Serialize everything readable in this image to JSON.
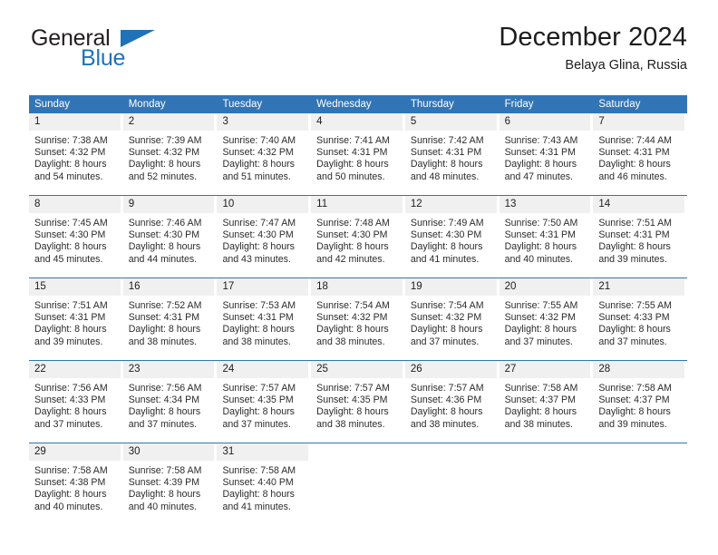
{
  "brand": {
    "name_part1": "General",
    "name_part2": "Blue",
    "logo_icon": "triangle-flag-icon",
    "accent_color": "#1f72b8"
  },
  "header": {
    "title": "December 2024",
    "subtitle": "Belaya Glina, Russia"
  },
  "calendar": {
    "header_color": "#3275b6",
    "daynum_bg": "#f0f0f0",
    "weekday_headers": [
      "Sunday",
      "Monday",
      "Tuesday",
      "Wednesday",
      "Thursday",
      "Friday",
      "Saturday"
    ],
    "weeks": [
      [
        {
          "day": "1",
          "sunrise": "Sunrise: 7:38 AM",
          "sunset": "Sunset: 4:32 PM",
          "daylight_line1": "Daylight: 8 hours",
          "daylight_line2": "and 54 minutes."
        },
        {
          "day": "2",
          "sunrise": "Sunrise: 7:39 AM",
          "sunset": "Sunset: 4:32 PM",
          "daylight_line1": "Daylight: 8 hours",
          "daylight_line2": "and 52 minutes."
        },
        {
          "day": "3",
          "sunrise": "Sunrise: 7:40 AM",
          "sunset": "Sunset: 4:32 PM",
          "daylight_line1": "Daylight: 8 hours",
          "daylight_line2": "and 51 minutes."
        },
        {
          "day": "4",
          "sunrise": "Sunrise: 7:41 AM",
          "sunset": "Sunset: 4:31 PM",
          "daylight_line1": "Daylight: 8 hours",
          "daylight_line2": "and 50 minutes."
        },
        {
          "day": "5",
          "sunrise": "Sunrise: 7:42 AM",
          "sunset": "Sunset: 4:31 PM",
          "daylight_line1": "Daylight: 8 hours",
          "daylight_line2": "and 48 minutes."
        },
        {
          "day": "6",
          "sunrise": "Sunrise: 7:43 AM",
          "sunset": "Sunset: 4:31 PM",
          "daylight_line1": "Daylight: 8 hours",
          "daylight_line2": "and 47 minutes."
        },
        {
          "day": "7",
          "sunrise": "Sunrise: 7:44 AM",
          "sunset": "Sunset: 4:31 PM",
          "daylight_line1": "Daylight: 8 hours",
          "daylight_line2": "and 46 minutes."
        }
      ],
      [
        {
          "day": "8",
          "sunrise": "Sunrise: 7:45 AM",
          "sunset": "Sunset: 4:30 PM",
          "daylight_line1": "Daylight: 8 hours",
          "daylight_line2": "and 45 minutes."
        },
        {
          "day": "9",
          "sunrise": "Sunrise: 7:46 AM",
          "sunset": "Sunset: 4:30 PM",
          "daylight_line1": "Daylight: 8 hours",
          "daylight_line2": "and 44 minutes."
        },
        {
          "day": "10",
          "sunrise": "Sunrise: 7:47 AM",
          "sunset": "Sunset: 4:30 PM",
          "daylight_line1": "Daylight: 8 hours",
          "daylight_line2": "and 43 minutes."
        },
        {
          "day": "11",
          "sunrise": "Sunrise: 7:48 AM",
          "sunset": "Sunset: 4:30 PM",
          "daylight_line1": "Daylight: 8 hours",
          "daylight_line2": "and 42 minutes."
        },
        {
          "day": "12",
          "sunrise": "Sunrise: 7:49 AM",
          "sunset": "Sunset: 4:30 PM",
          "daylight_line1": "Daylight: 8 hours",
          "daylight_line2": "and 41 minutes."
        },
        {
          "day": "13",
          "sunrise": "Sunrise: 7:50 AM",
          "sunset": "Sunset: 4:31 PM",
          "daylight_line1": "Daylight: 8 hours",
          "daylight_line2": "and 40 minutes."
        },
        {
          "day": "14",
          "sunrise": "Sunrise: 7:51 AM",
          "sunset": "Sunset: 4:31 PM",
          "daylight_line1": "Daylight: 8 hours",
          "daylight_line2": "and 39 minutes."
        }
      ],
      [
        {
          "day": "15",
          "sunrise": "Sunrise: 7:51 AM",
          "sunset": "Sunset: 4:31 PM",
          "daylight_line1": "Daylight: 8 hours",
          "daylight_line2": "and 39 minutes."
        },
        {
          "day": "16",
          "sunrise": "Sunrise: 7:52 AM",
          "sunset": "Sunset: 4:31 PM",
          "daylight_line1": "Daylight: 8 hours",
          "daylight_line2": "and 38 minutes."
        },
        {
          "day": "17",
          "sunrise": "Sunrise: 7:53 AM",
          "sunset": "Sunset: 4:31 PM",
          "daylight_line1": "Daylight: 8 hours",
          "daylight_line2": "and 38 minutes."
        },
        {
          "day": "18",
          "sunrise": "Sunrise: 7:54 AM",
          "sunset": "Sunset: 4:32 PM",
          "daylight_line1": "Daylight: 8 hours",
          "daylight_line2": "and 38 minutes."
        },
        {
          "day": "19",
          "sunrise": "Sunrise: 7:54 AM",
          "sunset": "Sunset: 4:32 PM",
          "daylight_line1": "Daylight: 8 hours",
          "daylight_line2": "and 37 minutes."
        },
        {
          "day": "20",
          "sunrise": "Sunrise: 7:55 AM",
          "sunset": "Sunset: 4:32 PM",
          "daylight_line1": "Daylight: 8 hours",
          "daylight_line2": "and 37 minutes."
        },
        {
          "day": "21",
          "sunrise": "Sunrise: 7:55 AM",
          "sunset": "Sunset: 4:33 PM",
          "daylight_line1": "Daylight: 8 hours",
          "daylight_line2": "and 37 minutes."
        }
      ],
      [
        {
          "day": "22",
          "sunrise": "Sunrise: 7:56 AM",
          "sunset": "Sunset: 4:33 PM",
          "daylight_line1": "Daylight: 8 hours",
          "daylight_line2": "and 37 minutes."
        },
        {
          "day": "23",
          "sunrise": "Sunrise: 7:56 AM",
          "sunset": "Sunset: 4:34 PM",
          "daylight_line1": "Daylight: 8 hours",
          "daylight_line2": "and 37 minutes."
        },
        {
          "day": "24",
          "sunrise": "Sunrise: 7:57 AM",
          "sunset": "Sunset: 4:35 PM",
          "daylight_line1": "Daylight: 8 hours",
          "daylight_line2": "and 37 minutes."
        },
        {
          "day": "25",
          "sunrise": "Sunrise: 7:57 AM",
          "sunset": "Sunset: 4:35 PM",
          "daylight_line1": "Daylight: 8 hours",
          "daylight_line2": "and 38 minutes."
        },
        {
          "day": "26",
          "sunrise": "Sunrise: 7:57 AM",
          "sunset": "Sunset: 4:36 PM",
          "daylight_line1": "Daylight: 8 hours",
          "daylight_line2": "and 38 minutes."
        },
        {
          "day": "27",
          "sunrise": "Sunrise: 7:58 AM",
          "sunset": "Sunset: 4:37 PM",
          "daylight_line1": "Daylight: 8 hours",
          "daylight_line2": "and 38 minutes."
        },
        {
          "day": "28",
          "sunrise": "Sunrise: 7:58 AM",
          "sunset": "Sunset: 4:37 PM",
          "daylight_line1": "Daylight: 8 hours",
          "daylight_line2": "and 39 minutes."
        }
      ],
      [
        {
          "day": "29",
          "sunrise": "Sunrise: 7:58 AM",
          "sunset": "Sunset: 4:38 PM",
          "daylight_line1": "Daylight: 8 hours",
          "daylight_line2": "and 40 minutes."
        },
        {
          "day": "30",
          "sunrise": "Sunrise: 7:58 AM",
          "sunset": "Sunset: 4:39 PM",
          "daylight_line1": "Daylight: 8 hours",
          "daylight_line2": "and 40 minutes."
        },
        {
          "day": "31",
          "sunrise": "Sunrise: 7:58 AM",
          "sunset": "Sunset: 4:40 PM",
          "daylight_line1": "Daylight: 8 hours",
          "daylight_line2": "and 41 minutes."
        },
        {
          "day": "",
          "sunrise": "",
          "sunset": "",
          "daylight_line1": "",
          "daylight_line2": ""
        },
        {
          "day": "",
          "sunrise": "",
          "sunset": "",
          "daylight_line1": "",
          "daylight_line2": ""
        },
        {
          "day": "",
          "sunrise": "",
          "sunset": "",
          "daylight_line1": "",
          "daylight_line2": ""
        },
        {
          "day": "",
          "sunrise": "",
          "sunset": "",
          "daylight_line1": "",
          "daylight_line2": ""
        }
      ]
    ]
  }
}
